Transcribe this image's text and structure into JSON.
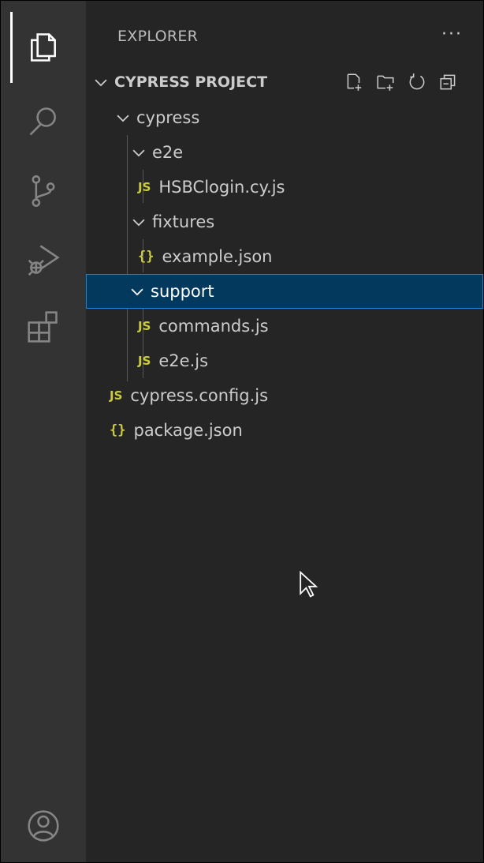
{
  "sidebar": {
    "header": "EXPLORER",
    "more": "···",
    "section_title": "CYPRESS PROJECT"
  },
  "tree": {
    "cypress": "cypress",
    "e2e_folder": "e2e",
    "hsbc_file": "HSBClogin.cy.js",
    "fixtures": "fixtures",
    "example_json": "example.json",
    "support": "support",
    "commands_js": "commands.js",
    "e2e_js": "e2e.js",
    "cypress_config": "cypress.config.js",
    "package_json": "package.json"
  },
  "file_icons": {
    "js": "JS",
    "json": "{}"
  },
  "icons": {
    "activity": [
      "explorer-icon",
      "search-icon",
      "source-control-icon",
      "run-debug-icon",
      "extensions-icon",
      "account-icon"
    ],
    "section_actions": [
      "new-file-icon",
      "new-folder-icon",
      "refresh-icon",
      "collapse-all-icon"
    ]
  },
  "colors": {
    "background": "#252526",
    "activity_bar": "#333333",
    "selection": "#04395e",
    "selection_border": "#1a82d9",
    "js_icon": "#cbcb41",
    "text": "#cccccc"
  }
}
